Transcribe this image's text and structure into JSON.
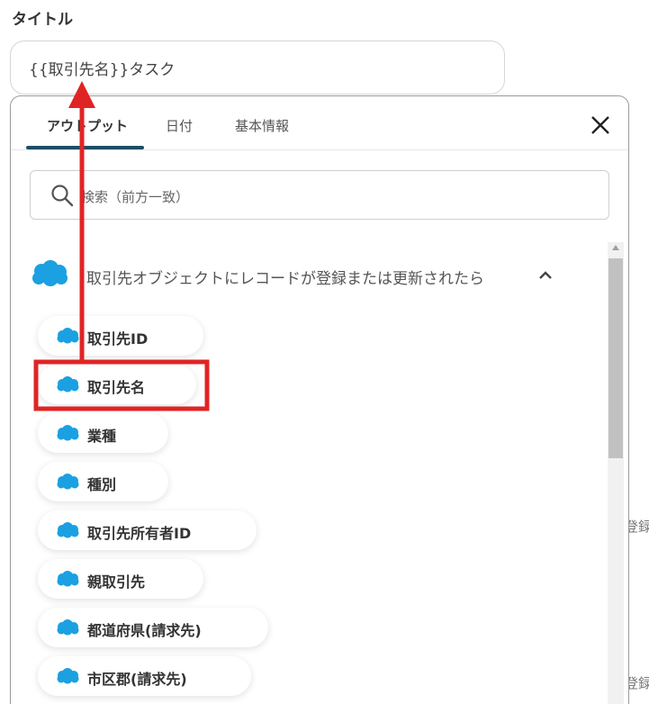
{
  "field": {
    "label": "タイトル",
    "value": "{{取引先名}}タスク"
  },
  "popup": {
    "tabs": [
      {
        "label": "アウトプット"
      },
      {
        "label": "日付"
      },
      {
        "label": "基本情報"
      }
    ],
    "active_tab": "アウトプット",
    "search": {
      "placeholder": "検索（前方一致）"
    },
    "section": {
      "title": "取引先オブジェクトにレコードが登録または更新されたら",
      "icon": "salesforce-cloud-icon",
      "expanded": true
    },
    "items": [
      {
        "label": "取引先ID"
      },
      {
        "label": "取引先名"
      },
      {
        "label": "業種"
      },
      {
        "label": "種別"
      },
      {
        "label": "取引先所有者ID"
      },
      {
        "label": "親取引先"
      },
      {
        "label": "都道府県(請求先)"
      },
      {
        "label": "市区郡(請求先)"
      }
    ],
    "highlighted_item": "取引先名"
  },
  "side_text": {
    "upper": "登録",
    "lower": "登録"
  },
  "colors": {
    "accent": "#1d4e63",
    "salesforce_blue": "#1ba0e1",
    "highlight_red": "#e02424"
  }
}
